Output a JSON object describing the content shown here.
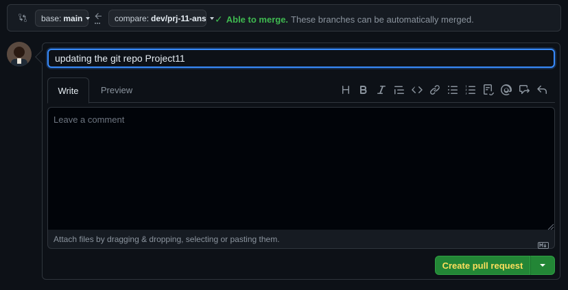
{
  "compare": {
    "base_prefix": "base:",
    "base_branch": "main",
    "compare_prefix": "compare:",
    "compare_branch": "dev/prj-11-ans",
    "merge_status": "Able to merge.",
    "merge_message": "These branches can be automatically merged."
  },
  "form": {
    "title_value": "updating the git repo Project11",
    "tabs": [
      {
        "label": "Write",
        "active": true
      },
      {
        "label": "Preview",
        "active": false
      }
    ],
    "toolbar_icons": [
      "heading-icon",
      "bold-icon",
      "italic-icon",
      "quote-icon",
      "code-icon",
      "link-icon",
      "bulleted-list-icon",
      "numbered-list-icon",
      "task-list-icon",
      "mention-icon",
      "cross-reference-icon",
      "undo-icon"
    ],
    "comment_placeholder": "Leave a comment",
    "attach_text": "Attach files by dragging & dropping, selecting or pasting them.",
    "submit_label": "Create pull request"
  },
  "colors": {
    "accent_blue": "#388bfd",
    "success_green": "#3fb950",
    "button_green": "#238636",
    "button_text": "#ffdf5d",
    "background": "#0d1117"
  }
}
